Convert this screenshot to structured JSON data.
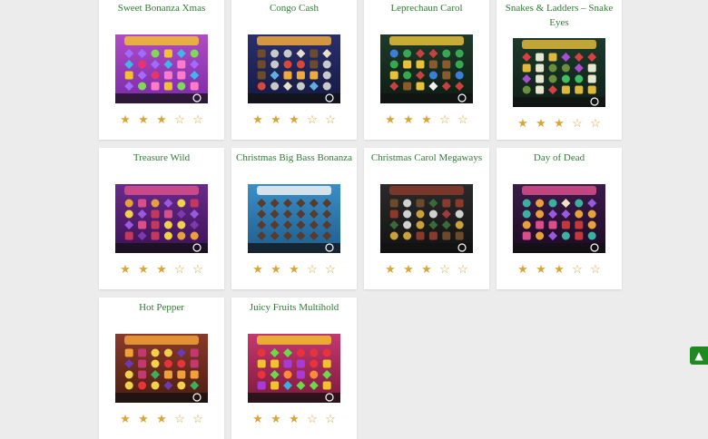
{
  "games": [
    {
      "title": "Sweet Bonanza Xmas",
      "rating": 3,
      "max_rating": 5,
      "theme": "candy"
    },
    {
      "title": "Congo Cash",
      "rating": 3,
      "max_rating": 5,
      "theme": "jungle"
    },
    {
      "title": "Leprechaun Carol",
      "rating": 3,
      "max_rating": 5,
      "theme": "leprechaun"
    },
    {
      "title": "Snakes & Ladders – Snake Eyes",
      "rating": 3,
      "max_rating": 5,
      "theme": "snakes"
    },
    {
      "title": "Treasure Wild",
      "rating": 3,
      "max_rating": 5,
      "theme": "treasure"
    },
    {
      "title": "Christmas Big Bass Bonanza",
      "rating": 3,
      "max_rating": 5,
      "theme": "bass"
    },
    {
      "title": "Christmas Carol Megaways",
      "rating": 3,
      "max_rating": 5,
      "theme": "carol"
    },
    {
      "title": "Day of Dead",
      "rating": 3,
      "max_rating": 5,
      "theme": "dead"
    },
    {
      "title": "Hot Pepper",
      "rating": 3,
      "max_rating": 5,
      "theme": "pepper"
    },
    {
      "title": "Juicy Fruits Multihold",
      "rating": 3,
      "max_rating": 5,
      "theme": "fruits"
    }
  ],
  "scroll_top_icon": "chevron-up-icon",
  "colors": {
    "title": "#2e7d32",
    "star": "#d9a636",
    "accent_button": "#1f8a1f"
  }
}
